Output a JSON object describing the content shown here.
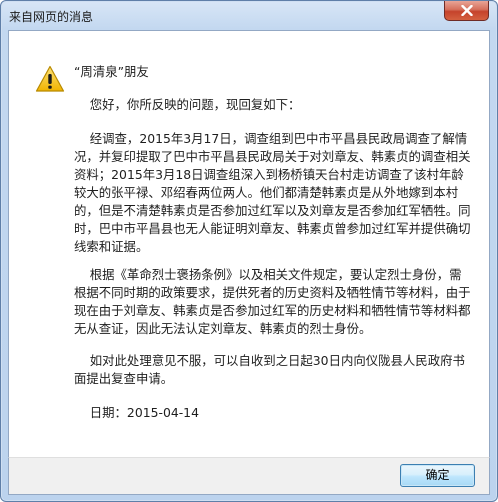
{
  "window": {
    "title": "来自网页的消息"
  },
  "message": {
    "greeting": "“周清泉”朋友",
    "hello": "    您好，你所反映的问题，现回复如下：",
    "investigation": "    经调查，2015年3月17日，调查组到巴中市平昌县民政局调查了解情况，并复印提取了巴中市平昌县民政局关于对刘章友、韩素贞的调查相关资料；2015年3月18日调查组深入到杨桥镇天台村走访调查了该村年龄较大的张平禄、邓绍春两位两人。他们都清楚韩素贞是从外地嫁到本村的，但是不清楚韩素贞是否参加过红军以及刘章友是否参加红军牺牲。同时，巴中市平昌县也无人能证明刘章友、韩素贞曾参加过红军并提供确切线索和证据。",
    "rules": "    根据《革命烈士褒扬条例》以及相关文件规定，要认定烈士身份，需根据不同时期的政策要求，提供死者的历史资料及牺牲情节等材料，由于现在由于刘章友、韩素贞是否参加过红军的历史材料和牺牲情节等材料都无从查证，因此无法认定刘章友、韩素贞的烈士身份。",
    "appeal": "    如对此处理意见不服，可以自收到之日起30日内向仪陇县人民政府书面提出复查申请。",
    "date": "    日期：2015-04-14"
  },
  "buttons": {
    "ok_label": "确定"
  },
  "icons": {
    "dialog_icon": "warning-icon",
    "close_icon": "close-icon"
  },
  "colors": {
    "close_button": "#c5432c",
    "warning_fill": "#f6c31c",
    "ok_button_border": "#3c7fb1"
  }
}
